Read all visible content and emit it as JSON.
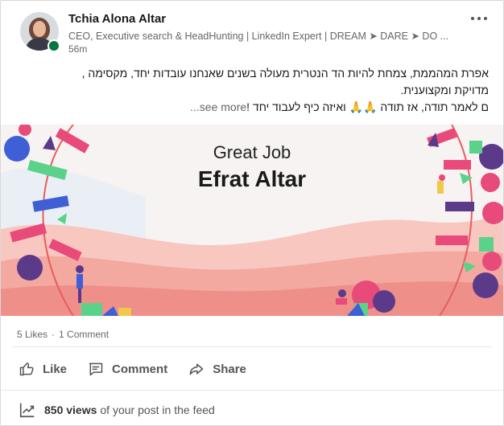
{
  "post": {
    "author_name": "Tchia Alona Altar",
    "headline": "CEO, Executive search & HeadHunting | LinkedIn Expert | DREAM ➤ DARE ➤ DO ...",
    "time": "56m",
    "text_line1": "אפרת המהממת, צמחת להיות הד הנטרית מעולה בשנים שאנחנו עובדות יחד, מקסימה ,",
    "text_line2": "מדויקת ומקצוענית.",
    "text_line3": "ם לאמר תודה, אז תודה 🙏🙏 ואיזה כיף לעבוד יחד !",
    "see_more": "...see more"
  },
  "image": {
    "subtitle": "Great Job",
    "title": "Efrat Altar"
  },
  "social": {
    "likes": "5 Likes",
    "separator": "·",
    "comments": "1 Comment"
  },
  "actions": {
    "like": "Like",
    "comment": "Comment",
    "share": "Share"
  },
  "views": {
    "count": "850 views",
    "suffix": "of your post in the feed"
  },
  "icons": {
    "more": "ellipsis-icon",
    "like": "thumbs-up-icon",
    "comment": "comment-icon",
    "share": "share-arrow-icon",
    "views": "trending-chart-icon"
  },
  "colors": {
    "presence": "#057642",
    "image_background_pink": "#f3a8a0",
    "image_background_light": "#f7f3f2"
  }
}
